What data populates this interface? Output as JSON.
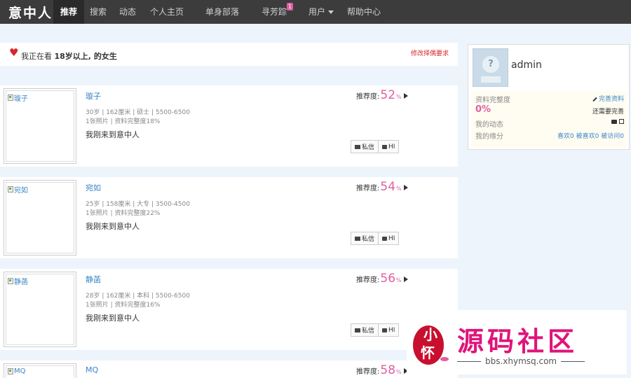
{
  "nav": {
    "logo": "意中人",
    "items": [
      {
        "label": "推荐",
        "active": true
      },
      {
        "label": "搜索"
      },
      {
        "label": "动态"
      },
      {
        "label": "个人主页"
      },
      {
        "label": "单身部落"
      },
      {
        "label": "寻芳踪",
        "badge": "1"
      },
      {
        "label": "用户",
        "has_dropdown": true
      },
      {
        "label": "帮助中心"
      }
    ]
  },
  "status": {
    "prefix": "我正在看 ",
    "criteria": "18岁以上, 的女生",
    "edit_link": "修改择偶要求"
  },
  "score_label": "推荐度:",
  "percent_sign": "%",
  "btn_message": "私信",
  "btn_hi": "HI",
  "users": [
    {
      "name": "璇子",
      "alt": "璇子",
      "meta": "30岁 | 162厘米 | 硕士 | 5500-6500",
      "stats": "1张照片 | 资料完整度18%",
      "intro": "我刚来到意中人",
      "score": "52"
    },
    {
      "name": "宛如",
      "alt": "宛如",
      "meta": "25岁 | 158厘米 | 大专 | 3500-4500",
      "stats": "1张照片 | 资料完整度22%",
      "intro": "我刚来到意中人",
      "score": "54"
    },
    {
      "name": "静菡",
      "alt": "静菡",
      "meta": "28岁 | 162厘米 | 本科 | 5500-6500",
      "stats": "1张照片 | 资料完整度16%",
      "intro": "我刚来到意中人",
      "score": "56"
    },
    {
      "name": "MQ",
      "alt": "MQ",
      "score": "58"
    }
  ],
  "sidebar": {
    "username": "admin",
    "avatar_mark": "?",
    "profile_label": "资料完整度",
    "profile_pct": "0%",
    "complete_link": "完善资料",
    "complete_hint": "还需要完善",
    "dynamics_label": "我的动态",
    "fate_label": "我的缘分",
    "likes": "喜欢0",
    "liked": "被喜欢0",
    "visited": "被访问0"
  },
  "watermark": {
    "title": "源码社区",
    "url": "bbs.xhymsq.com",
    "seal_chars": [
      "小",
      "怀"
    ]
  },
  "colors": {
    "nav_bg": "#3d3c3c",
    "accent_pink": "#e05ea2",
    "link_blue": "#3a86c8",
    "heart_red": "#d8262a",
    "watermark_magenta": "#e0147a"
  }
}
